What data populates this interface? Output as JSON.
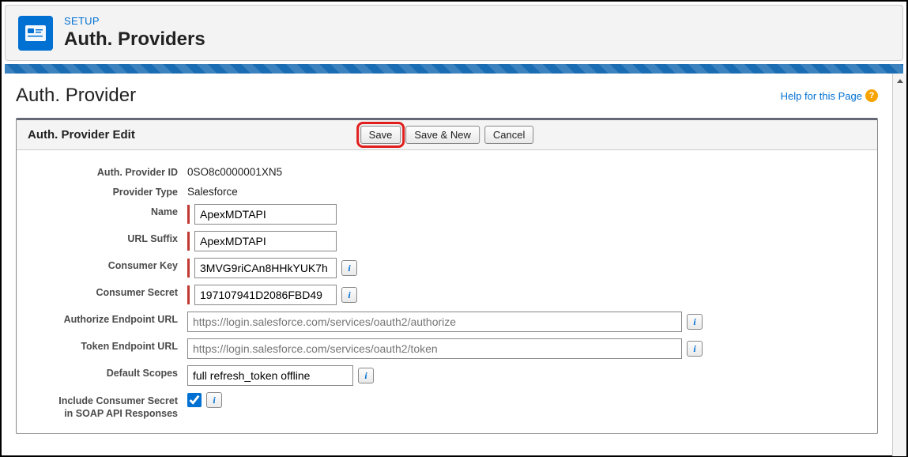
{
  "header": {
    "setup_label": "SETUP",
    "title": "Auth. Providers"
  },
  "page": {
    "heading": "Auth. Provider",
    "help_text": "Help for this Page"
  },
  "panel": {
    "title": "Auth. Provider Edit",
    "buttons": {
      "save": "Save",
      "save_new": "Save & New",
      "cancel": "Cancel"
    }
  },
  "form": {
    "provider_id": {
      "label": "Auth. Provider ID",
      "value": "0SO8c0000001XN5"
    },
    "provider_type": {
      "label": "Provider Type",
      "value": "Salesforce"
    },
    "name": {
      "label": "Name",
      "value": "ApexMDTAPI"
    },
    "url_suffix": {
      "label": "URL Suffix",
      "value": "ApexMDTAPI"
    },
    "consumer_key": {
      "label": "Consumer Key",
      "value": "3MVG9riCAn8HHkYUK7h"
    },
    "consumer_secret": {
      "label": "Consumer Secret",
      "value": "197107941D2086FBD49"
    },
    "authorize_url": {
      "label": "Authorize Endpoint URL",
      "placeholder": "https://login.salesforce.com/services/oauth2/authorize"
    },
    "token_url": {
      "label": "Token Endpoint URL",
      "placeholder": "https://login.salesforce.com/services/oauth2/token"
    },
    "default_scopes": {
      "label": "Default Scopes",
      "value": "full refresh_token offline"
    },
    "include_secret": {
      "label": "Include Consumer Secret in SOAP API Responses",
      "checked": true
    }
  }
}
